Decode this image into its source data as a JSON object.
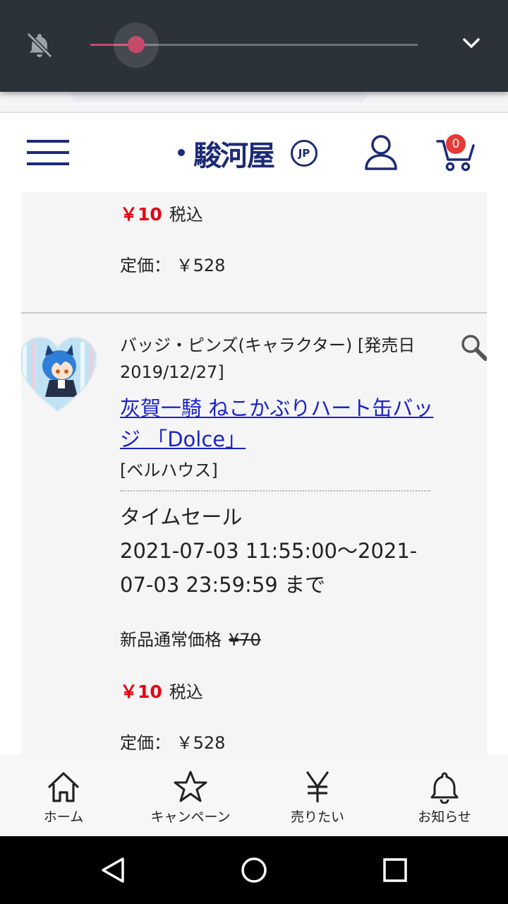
{
  "volume": {
    "level": 0.14,
    "accent": "#c84a6b"
  },
  "header": {
    "logo_text": "駿河屋",
    "logo_badge": "JP",
    "cart_count": "0",
    "brand_color": "#1c2a78"
  },
  "prev_item": {
    "sale_price": "￥10",
    "tax_label": "税込",
    "list_price": "定価： ￥528"
  },
  "item": {
    "category": "バッジ・ピンズ(キャラクター)  [発売日 2019/12/27]",
    "title": "灰賀一騎 ねこかぶりハート缶バッジ 「Dolce」",
    "maker": "[ベルハウス]",
    "timesale_label": "タイムセール",
    "timesale_period": "2021-07-03 11:55:00〜2021-07-03 23:59:59 まで",
    "normal_price_label": "新品通常価格",
    "normal_price": "¥70",
    "sale_price": "￥10",
    "tax_label": "税込",
    "list_price": "定価： ￥528"
  },
  "bottom_nav": [
    {
      "label": "ホーム",
      "icon": "home-icon"
    },
    {
      "label": "キャンペーン",
      "icon": "star-icon"
    },
    {
      "label": "売りたい",
      "icon": "yen-icon"
    },
    {
      "label": "お知らせ",
      "icon": "bell-icon"
    }
  ],
  "colors": {
    "price_red": "#e60012",
    "link_blue": "#1a22cc"
  }
}
